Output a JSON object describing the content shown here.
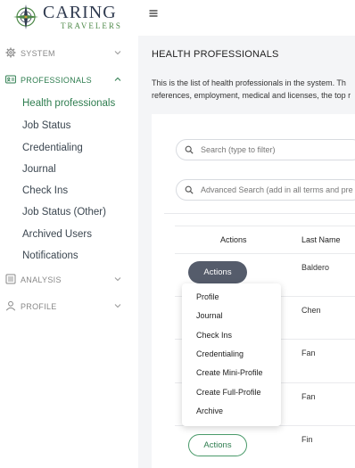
{
  "brand": {
    "name": "CARING",
    "tagline": "TRAVELERS"
  },
  "sidebar": {
    "groups": [
      {
        "label": "SYSTEM",
        "icon": "gear-icon"
      },
      {
        "label": "PROFESSIONALS",
        "icon": "id-card-icon"
      },
      {
        "label": "ANALYSIS",
        "icon": "list-icon"
      },
      {
        "label": "PROFILE",
        "icon": "user-icon"
      }
    ],
    "items": [
      "Health professionals",
      "Job Status",
      "Credentialing",
      "Journal",
      "Check Ins",
      "Job Status (Other)",
      "Archived Users",
      "Notifications"
    ]
  },
  "main": {
    "title": "HEALTH PROFESSIONALS",
    "description_line1": "This is the list of health professionals in the system. Th",
    "description_line2": "references, employment, medical and licenses, the top r",
    "search_placeholder": "Search (type to filter)",
    "advanced_placeholder": "Advanced Search (add in all terms and pre",
    "table": {
      "headers": [
        "Actions",
        "Last Name"
      ],
      "last_names": [
        "Baldero",
        "Chen",
        "Fan",
        "Fan",
        "Fin"
      ]
    },
    "actions_label": "Actions",
    "actions_menu": [
      "Profile",
      "Journal",
      "Check Ins",
      "Credentialing",
      "Create Mini-Profile",
      "Create Full-Profile",
      "Archive"
    ]
  },
  "colors": {
    "accent": "#2e7d4f",
    "dark_button": "#555c6b",
    "brand_navy": "#2f3a4f"
  }
}
